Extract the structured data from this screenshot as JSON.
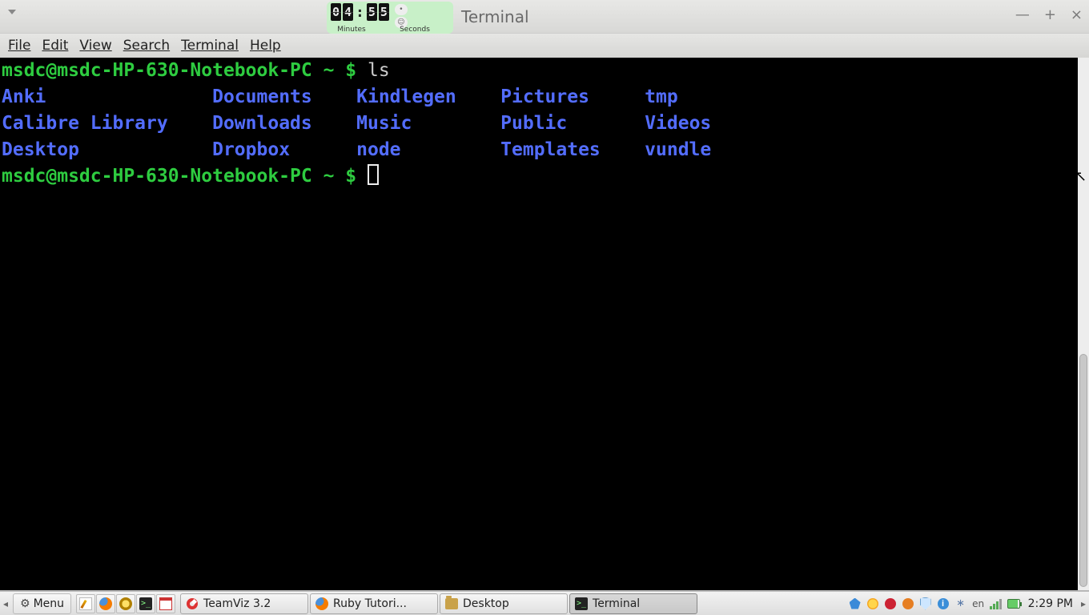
{
  "window": {
    "title": "Terminal"
  },
  "window_controls": {
    "min": "—",
    "max": "+",
    "close": "×"
  },
  "timer": {
    "minutes_d1": "0",
    "minutes_d2": "4",
    "seconds_d1": "5",
    "seconds_d2": "5",
    "minutes_label": "Minutes",
    "seconds_label": "Seconds"
  },
  "menubar": {
    "file": "File",
    "edit": "Edit",
    "view": "View",
    "search": "Search",
    "terminal": "Terminal",
    "help": "Help"
  },
  "terminal": {
    "prompt": "msdc@msdc-HP-630-Notebook-PC ~ $ ",
    "cmd": "ls",
    "cols": [
      [
        "Anki",
        "Calibre Library",
        "Desktop"
      ],
      [
        "Documents",
        "Downloads",
        "Dropbox"
      ],
      [
        "Kindlegen",
        "Music",
        "node"
      ],
      [
        "Pictures",
        "Public",
        "Templates"
      ],
      [
        "tmp",
        "Videos",
        "vundle"
      ]
    ]
  },
  "taskbar": {
    "menu_label": "Menu",
    "tasks": [
      {
        "label": "TeamViz 3.2"
      },
      {
        "label": "Ruby Tutori..."
      },
      {
        "label": "Desktop"
      },
      {
        "label": "Terminal"
      }
    ],
    "lang": "en",
    "clock": "2:29 PM"
  }
}
